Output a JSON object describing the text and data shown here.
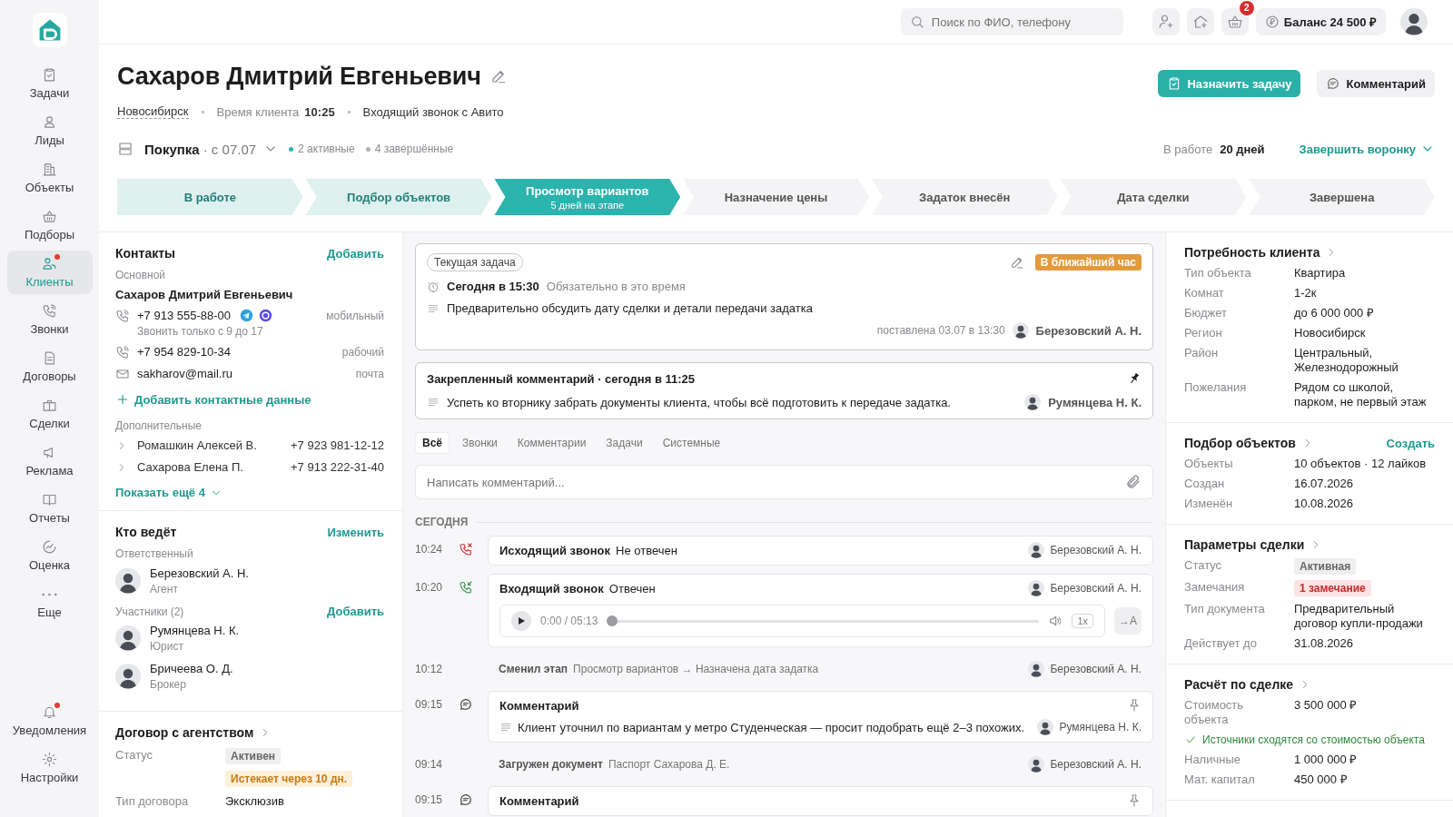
{
  "topbar": {
    "search_placeholder": "Поиск по ФИО, телефону",
    "cart_count": "2",
    "balance": "Баланс 24 500 ₽"
  },
  "sidebar": {
    "items": [
      {
        "label": "Задачи",
        "selected": false,
        "alert": false
      },
      {
        "label": "Лиды",
        "selected": false,
        "alert": false
      },
      {
        "label": "Объекты",
        "selected": false,
        "alert": false
      },
      {
        "label": "Подборы",
        "selected": false,
        "alert": false
      },
      {
        "label": "Клиенты",
        "selected": true,
        "alert": true
      },
      {
        "label": "Звонки",
        "selected": false,
        "alert": false
      },
      {
        "label": "Договоры",
        "selected": false,
        "alert": false
      },
      {
        "label": "Сделки",
        "selected": false,
        "alert": false
      },
      {
        "label": "Реклама",
        "selected": false,
        "alert": false
      },
      {
        "label": "Отчеты",
        "selected": false,
        "alert": false
      },
      {
        "label": "Оценка",
        "selected": false,
        "alert": false
      },
      {
        "label": "Еще",
        "selected": false,
        "alert": false
      }
    ],
    "bottom_items": [
      {
        "label": "Уведомления",
        "selected": false,
        "alert": true
      },
      {
        "label": "Настройки",
        "selected": false,
        "alert": false
      }
    ]
  },
  "client": {
    "name": "Сахаров Дмитрий Евгеньевич",
    "city": "Новосибирск",
    "time_label": "Время клиента",
    "time": "10:25",
    "source": "Входящий звонок с Авито"
  },
  "actions": [
    {
      "label": "Назначить задачу",
      "kind": "primary"
    },
    {
      "label": "Комментарий",
      "kind": "secondary"
    }
  ],
  "funnel": {
    "name": "Покупка",
    "since": "· с 07.07",
    "active": "2 активные",
    "finished": "4 завершённые",
    "work_label": "В работе",
    "work_value": "20 дней",
    "finish": "Завершить воронку"
  },
  "stages": [
    {
      "label": "В работе",
      "completed": true,
      "selected": false
    },
    {
      "label": "Подбор объектов",
      "completed": true,
      "selected": false
    },
    {
      "label": "Просмотр вариантов",
      "sub": "5 дней на этапе",
      "completed": false,
      "selected": true
    },
    {
      "label": "Назначение цены",
      "completed": false,
      "selected": false
    },
    {
      "label": "Задаток внесён",
      "completed": false,
      "selected": false
    },
    {
      "label": "Дата сделки",
      "completed": false,
      "selected": false
    },
    {
      "label": "Завершена",
      "completed": false,
      "selected": false
    }
  ],
  "contacts": {
    "title": "Контакты",
    "action": "Добавить",
    "main_label": "Основной",
    "main_name": "Сахаров Дмитрий Евгеньевич",
    "channels": [
      {
        "kind": "phone",
        "value": "+7 913 555-88-00",
        "messengers": [
          {
            "kind": "telegram"
          },
          {
            "kind": "max"
          }
        ],
        "hint": "Звонить только с 9 до 17",
        "type": "мобильный"
      },
      {
        "kind": "phone",
        "value": "+7 954 829-10-34",
        "type": "рабочий"
      },
      {
        "kind": "email",
        "value": "sakharov@mail.ru",
        "type": "почта"
      }
    ],
    "add_contact": "Добавить контактные данные",
    "extra_label": "Дополнительные",
    "extra": [
      {
        "name": "Ромашкин Алексей В.",
        "phone": "+7 923 981-12-12"
      },
      {
        "name": "Сахарова Елена П.",
        "phone": "+7 913 222-31-40"
      }
    ],
    "show_more": "Показать ещё 4"
  },
  "team": {
    "title": "Кто ведёт",
    "action": "Изменить",
    "responsible_label": "Ответственный",
    "responsible": {
      "name": "Березовский А. Н.",
      "role": "Агент"
    },
    "participants_label": "Участники (2)",
    "participants_action": "Добавить",
    "participants": [
      {
        "name": "Румянцева Н. К.",
        "role": "Юрист"
      },
      {
        "name": "Бричеева О. Д.",
        "role": "Брокер"
      }
    ]
  },
  "contract": {
    "title": "Договор с агентством",
    "rows": [
      {
        "label": "Статус",
        "kind": "tags",
        "tags": [
          {
            "text": "Активен",
            "kind": "neutral"
          },
          {
            "text": "Истекает через 10 дн.",
            "kind": "warning"
          }
        ]
      },
      {
        "label": "Тип договора",
        "kind": "text",
        "value": "Эксклюзив"
      }
    ]
  },
  "task": {
    "tag": "Текущая задача",
    "badge": "В ближайший час",
    "when": "Сегодня в 15:30",
    "when_note": "Обязательно в это время",
    "text": "Предварительно обсудить дату сделки и детали передачи задатка",
    "meta": "поставлена 03.07 в 13:30",
    "author": "Березовский А. Н."
  },
  "pinned": {
    "title": "Закрепленный комментарий · сегодня в 11:25",
    "text": "Успеть ко вторнику забрать документы клиента, чтобы всё подготовить к передаче задатка.",
    "author": "Румянцева Н. К."
  },
  "feed_tabs": [
    {
      "label": "Всё",
      "selected": true
    },
    {
      "label": "Звонки",
      "selected": false
    },
    {
      "label": "Комментарии",
      "selected": false
    },
    {
      "label": "Задачи",
      "selected": false
    },
    {
      "label": "Системные",
      "selected": false
    }
  ],
  "composer": {
    "placeholder": "Написать комментарий..."
  },
  "feed": {
    "day": "СЕГОДНЯ",
    "items": [
      {
        "kind": "outcall",
        "time": "10:24",
        "title": "Исходящий звонок",
        "status": "Не отвечен",
        "author": "Березовский А. Н."
      },
      {
        "kind": "incall",
        "time": "10:20",
        "title": "Входящий звонок",
        "status": "Отвечен",
        "author": "Березовский А. Н.",
        "player": {
          "position": "0:00 / 05:13",
          "level": 0,
          "speed": "1x",
          "transcribe": "→A"
        }
      },
      {
        "kind": "event",
        "time": "10:12",
        "title": "Сменил этап",
        "text": "Просмотр вариантов → Назначена дата задатка",
        "author": "Березовский А. Н."
      },
      {
        "kind": "comment",
        "time": "09:15",
        "title": "Комментарий",
        "text": "Клиент уточнил по вариантам у метро Студенческая — просит подобрать ещё 2–3 похожих.",
        "author": "Румянцева Н. К."
      },
      {
        "kind": "event",
        "time": "09:14",
        "title": "Загружен документ",
        "text": "Паспорт Сахарова Д. Е.",
        "author": "Березовский А. Н."
      },
      {
        "kind": "comment",
        "time": "09:15",
        "title": "Комментарий"
      }
    ]
  },
  "right_sections": [
    {
      "title": "Потребность клиента",
      "rows": [
        {
          "label": "Тип объекта",
          "kind": "text",
          "value": "Квартира"
        },
        {
          "label": "Комнат",
          "kind": "text",
          "value": "1-2к"
        },
        {
          "label": "Бюджет",
          "kind": "text",
          "value": "до 6 000 000 ₽"
        },
        {
          "label": "Регион",
          "kind": "text",
          "value": "Новосибирск"
        },
        {
          "label": "Район",
          "kind": "text",
          "value": "Центральный, Железнодорожный"
        },
        {
          "label": "Пожелания",
          "kind": "text",
          "value": "Рядом со школой, парком, не первый этаж"
        }
      ]
    },
    {
      "title": "Подбор объектов",
      "action": "Создать",
      "rows": [
        {
          "label": "Объекты",
          "kind": "text",
          "value": "10 объектов · 12 лайков"
        },
        {
          "label": "Создан",
          "kind": "text",
          "value": "16.07.2026"
        },
        {
          "label": "Изменён",
          "kind": "text",
          "value": "10.08.2026"
        }
      ]
    },
    {
      "title": "Параметры сделки",
      "rows": [
        {
          "label": "Статус",
          "kind": "tags",
          "tags": [
            {
              "text": "Активная",
              "kind": "neutral"
            }
          ]
        },
        {
          "label": "Замечания",
          "kind": "tags",
          "tags": [
            {
              "text": "1 замечание",
              "kind": "danger"
            }
          ]
        },
        {
          "label": "Тип документа",
          "kind": "text",
          "value": "Предварительный договор купли-продажи"
        },
        {
          "label": "Действует до",
          "kind": "text",
          "value": "31.08.2026"
        }
      ]
    },
    {
      "title": "Расчёт по сделке",
      "rows": [
        {
          "label": "Стоимость объекта",
          "kind": "text",
          "value": "3 500 000 ₽"
        },
        {
          "kind": "check",
          "text": "Источники сходятся со стоимостью объекта"
        },
        {
          "label": "Наличные",
          "kind": "text",
          "value": "1 000 000 ₽"
        },
        {
          "label": "Мат. капитал",
          "kind": "text",
          "value": "450 000 ₽"
        }
      ]
    }
  ]
}
